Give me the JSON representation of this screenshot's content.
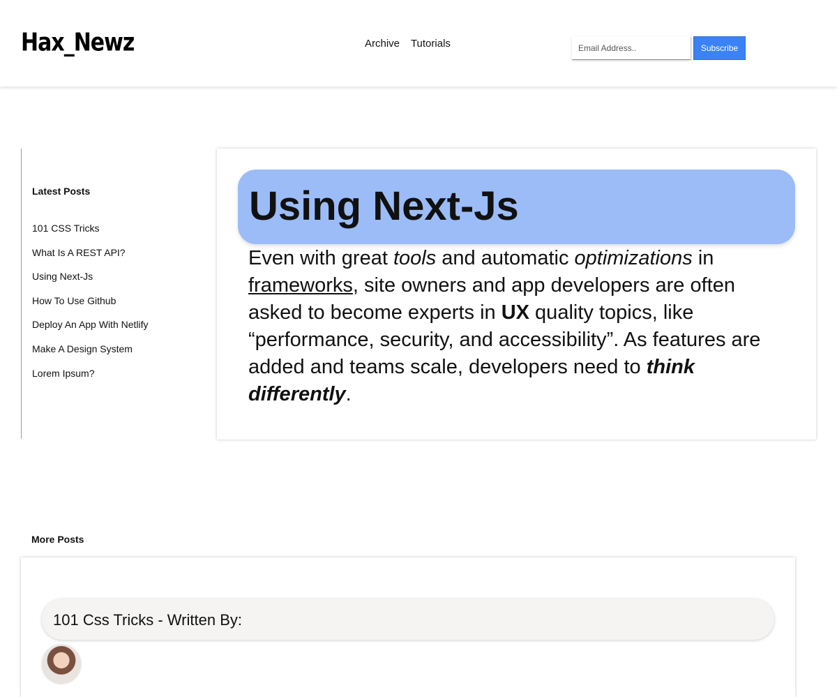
{
  "header": {
    "logo": "Hax_Newz",
    "nav": [
      "Archive",
      "Tutorials"
    ],
    "email_placeholder": "Email Address..",
    "subscribe_label": "Subscribe"
  },
  "sidebar": {
    "title": "Latest Posts",
    "items": [
      "101 CSS Tricks",
      "What Is A REST API?",
      "Using Next-Js",
      "How To Use Github",
      "Deploy An App With Netlify",
      "Make A Design System",
      "Lorem Ipsum?"
    ]
  },
  "article": {
    "title": "Using Next-Js",
    "body": {
      "t1": "Even with great ",
      "em_tools": "tools",
      "t2": " and automatic ",
      "em_optimizations": "optimizations",
      "t3": " in ",
      "link_frameworks": "frameworks",
      "t4": ", site owners and app developers are often asked to become experts in ",
      "strong_ux": "UX",
      "t5": " quality topics, like “performance, security, and accessibility”. As features are added and teams scale, developers need to ",
      "strong_em_think": "think differently",
      "t6": "."
    }
  },
  "more_posts": {
    "title": "More Posts",
    "cards": [
      {
        "heading": "101 Css Tricks - Written By:",
        "avatar": "author-avatar"
      }
    ]
  },
  "colors": {
    "accent": "#3b82f6",
    "title_bg": "#9bbcf7",
    "pill_bg": "#f5f4f3"
  }
}
